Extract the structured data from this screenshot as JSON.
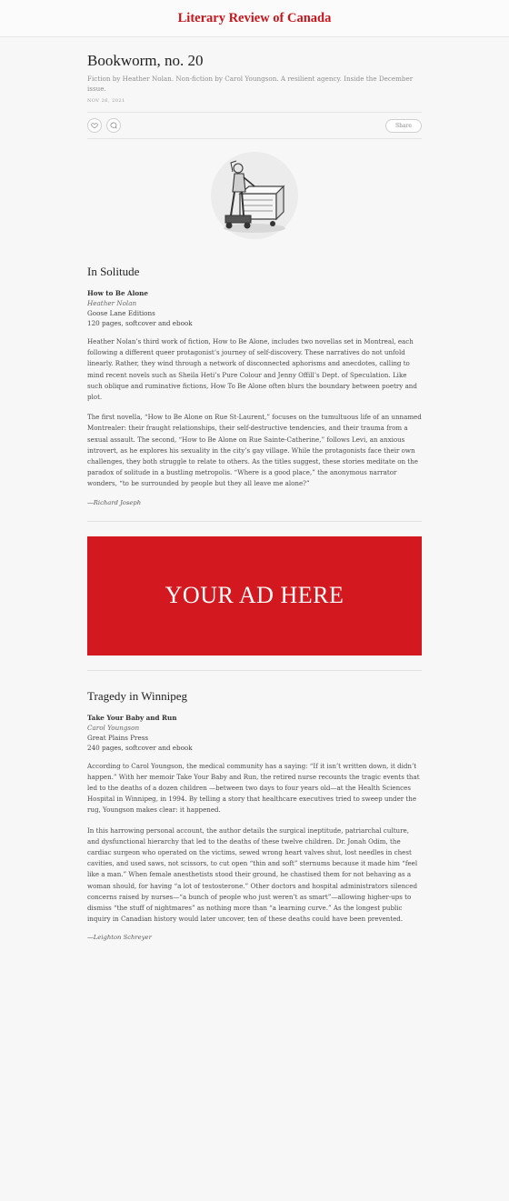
{
  "site": {
    "brand": "Literary Review of Canada"
  },
  "issue": {
    "title": "Bookworm, no. 20",
    "subtitle": "Fiction by Heather Nolan. Non-fiction by Carol Youngson. A resilient agency. Inside the December issue.",
    "date": "NOV 26, 2021",
    "share_label": "Share",
    "illustration_icon": "illustration-person-operating-machine"
  },
  "reviews": [
    {
      "heading": "In Solitude",
      "book": "How to Be Alone",
      "author": "Heather Nolan",
      "publisher": "Goose Lane Editions",
      "format": "120 pages, softcover and ebook",
      "paragraphs": [
        "Heather Nolan’s third work of fiction, How to Be Alone, includes two novellas set in Montreal, each following a different queer protagonist’s journey of self-discovery. These narratives do not unfold linearly. Rather, they wind through a network of disconnected aphorisms and anecdotes, calling to mind recent novels such as Sheila Heti’s Pure Colour and Jenny Offill’s Dept. of Speculation. Like such oblique and ruminative fictions, How To Be Alone often blurs the boundary between poetry and plot.",
        "The first novella, “How to Be Alone on Rue St-Laurent,” focuses on the tumultuous life of an unnamed Montrealer: their fraught relationships, their self-destructive tendencies, and their trauma from a sexual assault. The second, “How to Be Alone on Rue Sainte-Catherine,” follows Levi, an anxious introvert, as he explores his sexuality in the city’s gay village. While the protagonists face their own challenges, they both struggle to relate to others. As the titles suggest, these stories meditate on the paradox of solitude in a bustling metropolis. “Where is a good place,” the anonymous narrator wonders, “to be surrounded by people but they all leave me alone?”"
      ],
      "signature": "—Richard Joseph"
    },
    {
      "heading": "Tragedy in Winnipeg",
      "book": "Take Your Baby and Run",
      "author": "Carol Youngson",
      "publisher": "Great Plains Press",
      "format": "240 pages, softcover and ebook",
      "paragraphs": [
        "According to Carol Youngson, the medical community has a saying: “If it isn’t written down, it didn’t happen.” With her memoir Take Your Baby and Run, the retired nurse recounts the tragic events that led to the deaths of a dozen children —between two days to four years old—at the Health Sciences Hospital in Winnipeg, in 1994. By telling a story that healthcare executives tried to sweep under the rug, Youngson makes clear: it happened.",
        "In this harrowing personal account, the author details the surgical ineptitude, patriarchal culture, and dysfunctional hierarchy that led to the deaths of these twelve children. Dr. Jonah Odim, the cardiac surgeon who operated on the victims, sewed wrong heart valves shut, lost needles in chest cavities, and used saws, not scissors, to cut open “thin and soft” sternums because it made him “feel like a man.” When female anesthetists stood their ground, he chastised them for not behaving as a woman should, for having “a lot of testosterone.” Other doctors and hospital administrators silenced concerns raised by nurses—“a bunch of people who just weren’t as smart”—allowing higher-ups to dismiss “the stuff of nightmares” as nothing more than “a learning curve.” As the longest public inquiry in Canadian history would later uncover, ten of these deaths could have been prevented."
      ],
      "signature": "—Leighton Schreyer"
    }
  ],
  "ad": {
    "text": "YOUR AD HERE",
    "color": "#d3191f"
  },
  "colors": {
    "brand": "#c8161d",
    "ad_bg": "#d3191f"
  },
  "icons": {
    "like": "heart-icon",
    "comment": "comment-icon"
  }
}
